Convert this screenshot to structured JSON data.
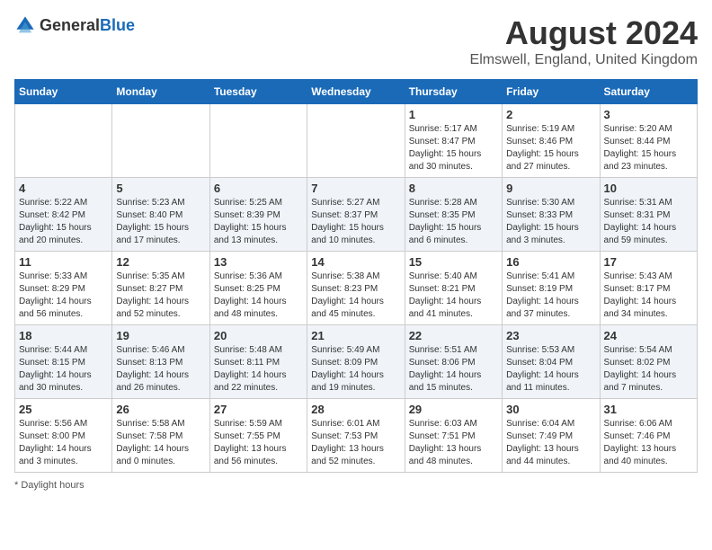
{
  "header": {
    "logo_general": "General",
    "logo_blue": "Blue",
    "title": "August 2024",
    "subtitle": "Elmswell, England, United Kingdom"
  },
  "days_of_week": [
    "Sunday",
    "Monday",
    "Tuesday",
    "Wednesday",
    "Thursday",
    "Friday",
    "Saturday"
  ],
  "footer": {
    "note": "Daylight hours"
  },
  "weeks": [
    [
      {
        "day": "",
        "info": ""
      },
      {
        "day": "",
        "info": ""
      },
      {
        "day": "",
        "info": ""
      },
      {
        "day": "",
        "info": ""
      },
      {
        "day": "1",
        "info": "Sunrise: 5:17 AM\nSunset: 8:47 PM\nDaylight: 15 hours\nand 30 minutes."
      },
      {
        "day": "2",
        "info": "Sunrise: 5:19 AM\nSunset: 8:46 PM\nDaylight: 15 hours\nand 27 minutes."
      },
      {
        "day": "3",
        "info": "Sunrise: 5:20 AM\nSunset: 8:44 PM\nDaylight: 15 hours\nand 23 minutes."
      }
    ],
    [
      {
        "day": "4",
        "info": "Sunrise: 5:22 AM\nSunset: 8:42 PM\nDaylight: 15 hours\nand 20 minutes."
      },
      {
        "day": "5",
        "info": "Sunrise: 5:23 AM\nSunset: 8:40 PM\nDaylight: 15 hours\nand 17 minutes."
      },
      {
        "day": "6",
        "info": "Sunrise: 5:25 AM\nSunset: 8:39 PM\nDaylight: 15 hours\nand 13 minutes."
      },
      {
        "day": "7",
        "info": "Sunrise: 5:27 AM\nSunset: 8:37 PM\nDaylight: 15 hours\nand 10 minutes."
      },
      {
        "day": "8",
        "info": "Sunrise: 5:28 AM\nSunset: 8:35 PM\nDaylight: 15 hours\nand 6 minutes."
      },
      {
        "day": "9",
        "info": "Sunrise: 5:30 AM\nSunset: 8:33 PM\nDaylight: 15 hours\nand 3 minutes."
      },
      {
        "day": "10",
        "info": "Sunrise: 5:31 AM\nSunset: 8:31 PM\nDaylight: 14 hours\nand 59 minutes."
      }
    ],
    [
      {
        "day": "11",
        "info": "Sunrise: 5:33 AM\nSunset: 8:29 PM\nDaylight: 14 hours\nand 56 minutes."
      },
      {
        "day": "12",
        "info": "Sunrise: 5:35 AM\nSunset: 8:27 PM\nDaylight: 14 hours\nand 52 minutes."
      },
      {
        "day": "13",
        "info": "Sunrise: 5:36 AM\nSunset: 8:25 PM\nDaylight: 14 hours\nand 48 minutes."
      },
      {
        "day": "14",
        "info": "Sunrise: 5:38 AM\nSunset: 8:23 PM\nDaylight: 14 hours\nand 45 minutes."
      },
      {
        "day": "15",
        "info": "Sunrise: 5:40 AM\nSunset: 8:21 PM\nDaylight: 14 hours\nand 41 minutes."
      },
      {
        "day": "16",
        "info": "Sunrise: 5:41 AM\nSunset: 8:19 PM\nDaylight: 14 hours\nand 37 minutes."
      },
      {
        "day": "17",
        "info": "Sunrise: 5:43 AM\nSunset: 8:17 PM\nDaylight: 14 hours\nand 34 minutes."
      }
    ],
    [
      {
        "day": "18",
        "info": "Sunrise: 5:44 AM\nSunset: 8:15 PM\nDaylight: 14 hours\nand 30 minutes."
      },
      {
        "day": "19",
        "info": "Sunrise: 5:46 AM\nSunset: 8:13 PM\nDaylight: 14 hours\nand 26 minutes."
      },
      {
        "day": "20",
        "info": "Sunrise: 5:48 AM\nSunset: 8:11 PM\nDaylight: 14 hours\nand 22 minutes."
      },
      {
        "day": "21",
        "info": "Sunrise: 5:49 AM\nSunset: 8:09 PM\nDaylight: 14 hours\nand 19 minutes."
      },
      {
        "day": "22",
        "info": "Sunrise: 5:51 AM\nSunset: 8:06 PM\nDaylight: 14 hours\nand 15 minutes."
      },
      {
        "day": "23",
        "info": "Sunrise: 5:53 AM\nSunset: 8:04 PM\nDaylight: 14 hours\nand 11 minutes."
      },
      {
        "day": "24",
        "info": "Sunrise: 5:54 AM\nSunset: 8:02 PM\nDaylight: 14 hours\nand 7 minutes."
      }
    ],
    [
      {
        "day": "25",
        "info": "Sunrise: 5:56 AM\nSunset: 8:00 PM\nDaylight: 14 hours\nand 3 minutes."
      },
      {
        "day": "26",
        "info": "Sunrise: 5:58 AM\nSunset: 7:58 PM\nDaylight: 14 hours\nand 0 minutes."
      },
      {
        "day": "27",
        "info": "Sunrise: 5:59 AM\nSunset: 7:55 PM\nDaylight: 13 hours\nand 56 minutes."
      },
      {
        "day": "28",
        "info": "Sunrise: 6:01 AM\nSunset: 7:53 PM\nDaylight: 13 hours\nand 52 minutes."
      },
      {
        "day": "29",
        "info": "Sunrise: 6:03 AM\nSunset: 7:51 PM\nDaylight: 13 hours\nand 48 minutes."
      },
      {
        "day": "30",
        "info": "Sunrise: 6:04 AM\nSunset: 7:49 PM\nDaylight: 13 hours\nand 44 minutes."
      },
      {
        "day": "31",
        "info": "Sunrise: 6:06 AM\nSunset: 7:46 PM\nDaylight: 13 hours\nand 40 minutes."
      }
    ]
  ]
}
